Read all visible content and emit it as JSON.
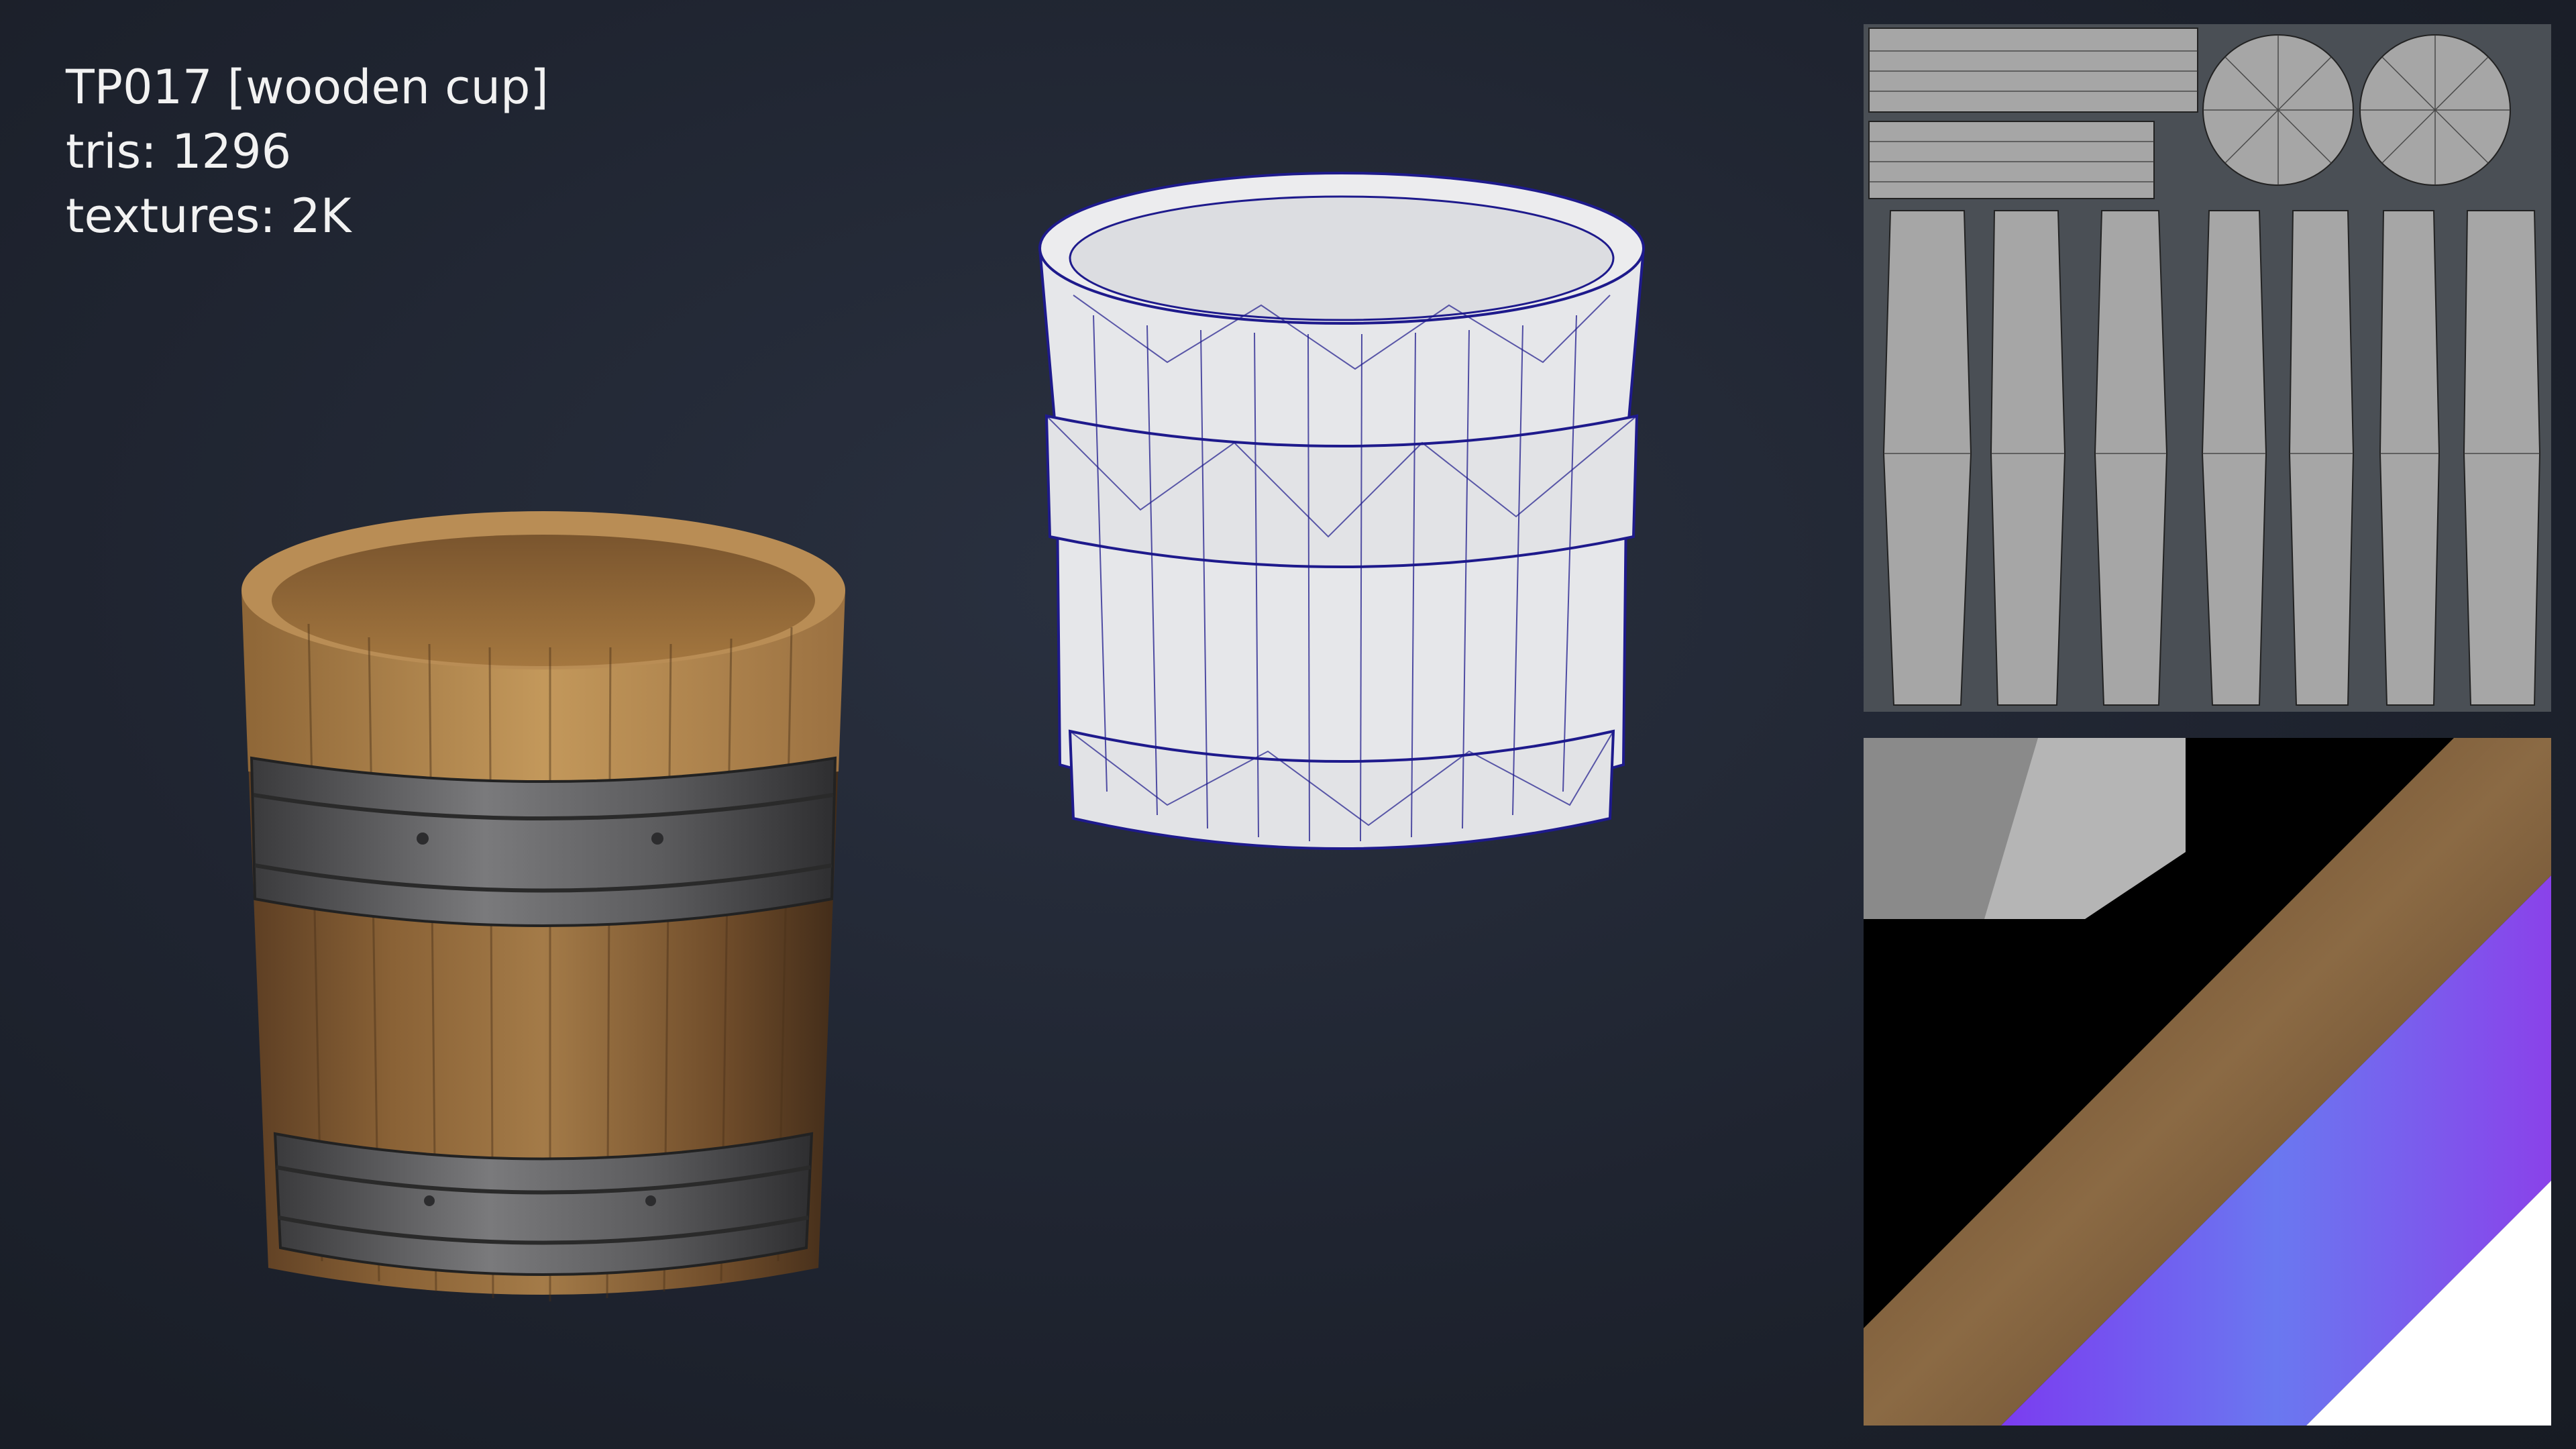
{
  "info": {
    "title": "TP017 [wooden cup]",
    "tris": "tris: 1296",
    "textures": "textures: 2K"
  },
  "colors": {
    "background": "#1f2430",
    "wood_light": "#b3884f",
    "wood_dark": "#5a3c22",
    "metal_band": "#6d6d6d",
    "wire_body": "#e8e8ea",
    "wire_line": "#1e1a8c",
    "uv_bg": "#4a4f55",
    "uv_island": "#a6a6a6",
    "normal_map": "#7b3cf0"
  },
  "views": [
    "textured-render",
    "wireframe-render",
    "uv-layout",
    "texture-maps"
  ]
}
